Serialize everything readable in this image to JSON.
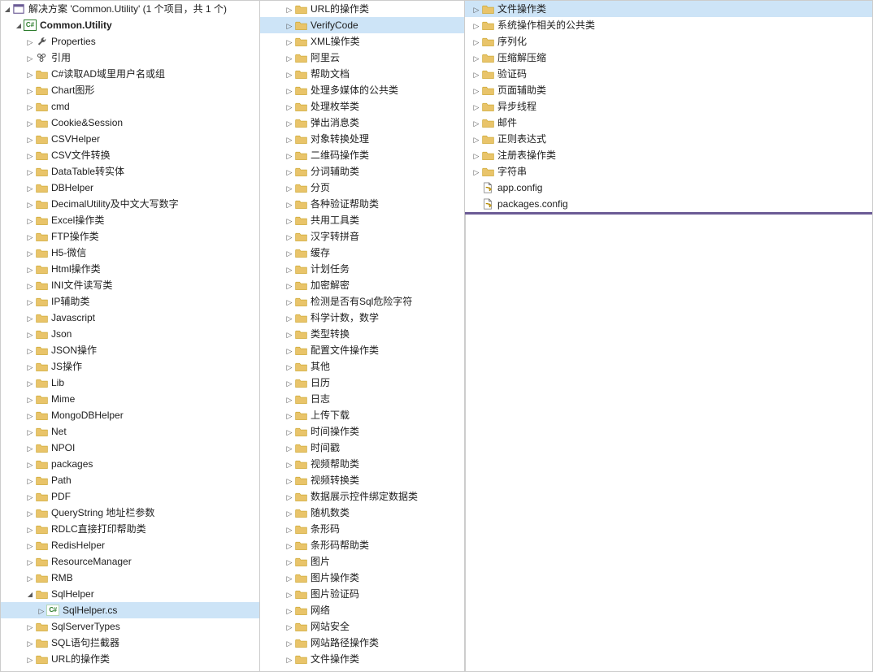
{
  "solution_label": "解决方案 'Common.Utility' (1 个项目，共 1 个)",
  "project_name": "Common.Utility",
  "properties_label": "Properties",
  "references_label": "引用",
  "col1_folders": [
    "C#读取AD域里用户名或组",
    "Chart图形",
    "cmd",
    "Cookie&Session",
    "CSVHelper",
    "CSV文件转换",
    "DataTable转实体",
    "DBHelper",
    "DecimalUtility及中文大写数字",
    "Excel操作类",
    "FTP操作类",
    "H5-微信",
    "Html操作类",
    "INI文件读写类",
    "IP辅助类",
    "Javascript",
    "Json",
    "JSON操作",
    "JS操作",
    "Lib",
    "Mime",
    "MongoDBHelper",
    "Net",
    "NPOI",
    "packages",
    "Path",
    "PDF",
    "QueryString 地址栏参数",
    "RDLC直接打印帮助类",
    "RedisHelper",
    "ResourceManager",
    "RMB"
  ],
  "sqlhelper_label": "SqlHelper",
  "sqlhelper_cs": "SqlHelper.cs",
  "col1_folders_after": [
    "SqlServerTypes",
    "SQL语句拦截器",
    "URL的操作类"
  ],
  "col2_folders_top": [
    "URL的操作类"
  ],
  "verifycode_label": "VerifyCode",
  "col2_folders_rest": [
    "XML操作类",
    "阿里云",
    "帮助文档",
    "处理多媒体的公共类",
    "处理枚举类",
    "弹出消息类",
    "对象转换处理",
    "二维码操作类",
    "分词辅助类",
    "分页",
    "各种验证帮助类",
    "共用工具类",
    "汉字转拼音",
    "缓存",
    "计划任务",
    "加密解密",
    "检测是否有Sql危险字符",
    "科学计数，数学",
    "类型转换",
    "配置文件操作类",
    "其他",
    "日历",
    "日志",
    "上传下载",
    "时间操作类",
    "时间戳",
    "视频帮助类",
    "视频转换类",
    "数据展示控件绑定数据类",
    "随机数类",
    "条形码",
    "条形码帮助类",
    "图片",
    "图片操作类",
    "图片验证码",
    "网络",
    "网站安全",
    "网站路径操作类",
    "文件操作类"
  ],
  "col3_sel": "文件操作类",
  "col3_folders": [
    "系统操作相关的公共类",
    "序列化",
    "压缩解压缩",
    "验证码",
    "页面辅助类",
    "异步线程",
    "邮件",
    "正则表达式",
    "注册表操作类",
    "字符串"
  ],
  "cfg_files": [
    "app.config",
    "packages.config"
  ]
}
